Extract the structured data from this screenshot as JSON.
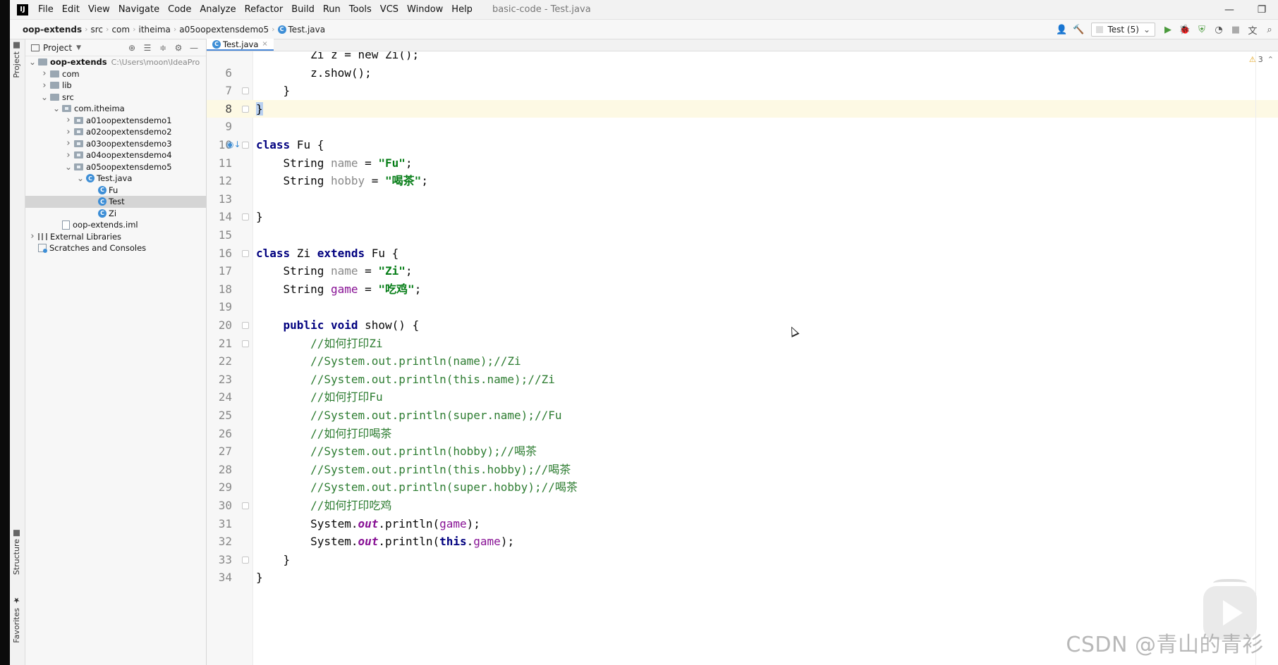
{
  "menubar": {
    "logo": "IJ",
    "items": [
      "File",
      "Edit",
      "View",
      "Navigate",
      "Code",
      "Analyze",
      "Refactor",
      "Build",
      "Run",
      "Tools",
      "VCS",
      "Window",
      "Help"
    ],
    "window_title": "basic-code - Test.java",
    "minimize": "—",
    "restore": "❐"
  },
  "breadcrumb": {
    "items": [
      "oop-extends",
      "src",
      "com",
      "itheima",
      "a05oopextensdemo5",
      "Test.java"
    ]
  },
  "toolbar": {
    "run_config": "Test (5)",
    "icons": [
      "user-icon",
      "hammer-icon",
      "run-icon",
      "debug-icon",
      "coverage-icon",
      "profile-icon",
      "stop-icon",
      "translate-icon",
      "search-icon"
    ]
  },
  "toolstrip": {
    "project_tab": "Project",
    "structure_tab": "Structure",
    "favorites_tab": "Favorites"
  },
  "project_panel": {
    "title": "Project",
    "tree": [
      {
        "label": "oop-extends",
        "path": "C:\\Users\\moon\\IdeaPro",
        "depth": 0,
        "icon": "module",
        "expanded": true,
        "bold": true
      },
      {
        "label": "com",
        "depth": 1,
        "icon": "folder",
        "arrow": "right"
      },
      {
        "label": "lib",
        "depth": 1,
        "icon": "folder",
        "arrow": "right"
      },
      {
        "label": "src",
        "depth": 1,
        "icon": "folder",
        "arrow": "down"
      },
      {
        "label": "com.itheima",
        "depth": 2,
        "icon": "package",
        "arrow": "down"
      },
      {
        "label": "a01oopextensdemo1",
        "depth": 3,
        "icon": "package",
        "arrow": "right"
      },
      {
        "label": "a02oopextensdemo2",
        "depth": 3,
        "icon": "package",
        "arrow": "right"
      },
      {
        "label": "a03oopextensdemo3",
        "depth": 3,
        "icon": "package",
        "arrow": "right"
      },
      {
        "label": "a04oopextensdemo4",
        "depth": 3,
        "icon": "package",
        "arrow": "right"
      },
      {
        "label": "a05oopextensdemo5",
        "depth": 3,
        "icon": "package",
        "arrow": "down"
      },
      {
        "label": "Test.java",
        "depth": 4,
        "icon": "class",
        "arrow": "down"
      },
      {
        "label": "Fu",
        "depth": 5,
        "icon": "class"
      },
      {
        "label": "Test",
        "depth": 5,
        "icon": "class",
        "selected": true
      },
      {
        "label": "Zi",
        "depth": 5,
        "icon": "class"
      },
      {
        "label": "oop-extends.iml",
        "depth": 2,
        "icon": "file"
      },
      {
        "label": "External Libraries",
        "depth": 0,
        "icon": "library",
        "arrow": "right"
      },
      {
        "label": "Scratches and Consoles",
        "depth": 0,
        "icon": "scratch"
      }
    ]
  },
  "editor": {
    "tab_label": "Test.java",
    "tab_close": "×",
    "warnings": "3",
    "current_line": 8,
    "lines": [
      {
        "n": "",
        "segs": [
          {
            "t": "        Zi z = new Zi();",
            "c": ""
          }
        ]
      },
      {
        "n": "6",
        "segs": [
          {
            "t": "        z.show();",
            "c": ""
          }
        ]
      },
      {
        "n": "7",
        "segs": [
          {
            "t": "    }",
            "c": ""
          }
        ]
      },
      {
        "n": "8",
        "segs": [
          {
            "t": "}",
            "c": "brace-hl"
          }
        ]
      },
      {
        "n": "9",
        "segs": []
      },
      {
        "n": "10",
        "segs": [
          {
            "t": "class",
            "c": "kw"
          },
          {
            "t": " Fu {",
            "c": ""
          }
        ]
      },
      {
        "n": "11",
        "segs": [
          {
            "t": "    String ",
            "c": ""
          },
          {
            "t": "name",
            "c": "fld-gray"
          },
          {
            "t": " = ",
            "c": ""
          },
          {
            "t": "\"Fu\"",
            "c": "str"
          },
          {
            "t": ";",
            "c": ""
          }
        ]
      },
      {
        "n": "12",
        "segs": [
          {
            "t": "    String ",
            "c": ""
          },
          {
            "t": "hobby",
            "c": "fld-gray"
          },
          {
            "t": " = ",
            "c": ""
          },
          {
            "t": "\"喝茶\"",
            "c": "str"
          },
          {
            "t": ";",
            "c": ""
          }
        ]
      },
      {
        "n": "13",
        "segs": []
      },
      {
        "n": "14",
        "segs": [
          {
            "t": "}",
            "c": ""
          }
        ]
      },
      {
        "n": "15",
        "segs": []
      },
      {
        "n": "16",
        "segs": [
          {
            "t": "class",
            "c": "kw"
          },
          {
            "t": " Zi ",
            "c": ""
          },
          {
            "t": "extends",
            "c": "kw"
          },
          {
            "t": " Fu {",
            "c": ""
          }
        ]
      },
      {
        "n": "17",
        "segs": [
          {
            "t": "    String ",
            "c": ""
          },
          {
            "t": "name",
            "c": "fld-gray"
          },
          {
            "t": " = ",
            "c": ""
          },
          {
            "t": "\"Zi\"",
            "c": "str"
          },
          {
            "t": ";",
            "c": ""
          }
        ]
      },
      {
        "n": "18",
        "segs": [
          {
            "t": "    String ",
            "c": ""
          },
          {
            "t": "game",
            "c": "fld"
          },
          {
            "t": " = ",
            "c": ""
          },
          {
            "t": "\"吃鸡\"",
            "c": "str"
          },
          {
            "t": ";",
            "c": ""
          }
        ]
      },
      {
        "n": "19",
        "segs": []
      },
      {
        "n": "20",
        "segs": [
          {
            "t": "    ",
            "c": ""
          },
          {
            "t": "public void",
            "c": "kw"
          },
          {
            "t": " show() {",
            "c": ""
          }
        ]
      },
      {
        "n": "21",
        "segs": [
          {
            "t": "        //如何打印Zi",
            "c": "cmt-cn"
          }
        ]
      },
      {
        "n": "22",
        "segs": [
          {
            "t": "        //System.out.println(name);//Zi",
            "c": "cmt-cn"
          }
        ]
      },
      {
        "n": "23",
        "segs": [
          {
            "t": "        //System.out.println(this.name);//Zi",
            "c": "cmt-cn"
          }
        ]
      },
      {
        "n": "24",
        "segs": [
          {
            "t": "        //如何打印Fu",
            "c": "cmt-cn"
          }
        ]
      },
      {
        "n": "25",
        "segs": [
          {
            "t": "        //System.out.println(super.name);//Fu",
            "c": "cmt-cn"
          }
        ]
      },
      {
        "n": "26",
        "segs": [
          {
            "t": "        //如何打印喝茶",
            "c": "cmt-cn"
          }
        ]
      },
      {
        "n": "27",
        "segs": [
          {
            "t": "        //System.out.println(hobby);//喝茶",
            "c": "cmt-cn"
          }
        ]
      },
      {
        "n": "28",
        "segs": [
          {
            "t": "        //System.out.println(this.hobby);//喝茶",
            "c": "cmt-cn"
          }
        ]
      },
      {
        "n": "29",
        "segs": [
          {
            "t": "        //System.out.println(super.hobby);//喝茶",
            "c": "cmt-cn"
          }
        ]
      },
      {
        "n": "30",
        "segs": [
          {
            "t": "        //如何打印吃鸡",
            "c": "cmt-cn"
          }
        ]
      },
      {
        "n": "31",
        "segs": [
          {
            "t": "        System.",
            "c": ""
          },
          {
            "t": "out",
            "c": "static-fld"
          },
          {
            "t": ".println(",
            "c": ""
          },
          {
            "t": "game",
            "c": "fld"
          },
          {
            "t": ");",
            "c": ""
          }
        ]
      },
      {
        "n": "32",
        "segs": [
          {
            "t": "        System.",
            "c": ""
          },
          {
            "t": "out",
            "c": "static-fld"
          },
          {
            "t": ".println(",
            "c": ""
          },
          {
            "t": "this",
            "c": "kw"
          },
          {
            "t": ".",
            "c": ""
          },
          {
            "t": "game",
            "c": "fld"
          },
          {
            "t": ");",
            "c": ""
          }
        ]
      },
      {
        "n": "33",
        "segs": [
          {
            "t": "    }",
            "c": ""
          }
        ]
      },
      {
        "n": "34",
        "segs": [
          {
            "t": "}",
            "c": ""
          }
        ]
      }
    ]
  },
  "watermark": "CSDN @青山的青衫"
}
